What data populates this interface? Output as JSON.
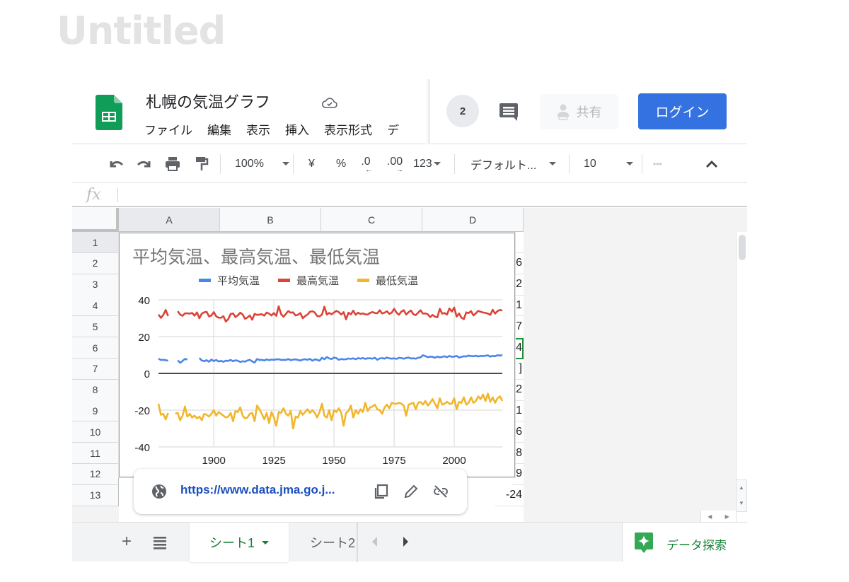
{
  "page": {
    "watermark": "Untitled"
  },
  "header": {
    "doc_title": "札幌の気温グラフ",
    "menu": [
      "ファイル",
      "編集",
      "表示",
      "挿入",
      "表示形式",
      "デ"
    ],
    "viewer_count": "2",
    "share_label": "共有",
    "login_label": "ログイン",
    "colors": {
      "login": "#3372e0",
      "sheets_green": "#0f9d58"
    }
  },
  "toolbar": {
    "zoom": "100%",
    "currency": "¥",
    "percent": "%",
    "decrease_decimal": ".0",
    "increase_decimal": ".00",
    "number_format": "123",
    "font": "デフォルト...",
    "font_size": "10",
    "more": "•••"
  },
  "formula_bar": {
    "label": "fx",
    "value": ""
  },
  "grid": {
    "columns": [
      "A",
      "B",
      "C",
      "D"
    ],
    "rows": [
      "1",
      "2",
      "3",
      "4",
      "5",
      "6",
      "7",
      "8",
      "9",
      "10",
      "11",
      "12",
      "13"
    ],
    "selected_cell": "D6",
    "column_d_visible": [
      "",
      "6",
      "2",
      "1",
      "7",
      "4",
      "]",
      "2",
      "1",
      "6",
      "8",
      "9",
      "-24"
    ]
  },
  "link_popup": {
    "url": "https://www.data.jma.go.j..."
  },
  "sheets": {
    "tabs": [
      "シート1",
      "シート2"
    ],
    "active": "シート1",
    "explore_label": "データ探索"
  },
  "chart_data": {
    "type": "line",
    "title": "平均気温、最高気温、最低気温",
    "legend_position": "top",
    "xlabel": "",
    "ylabel": "",
    "xlim": [
      1877,
      2020
    ],
    "ylim": [
      -40,
      40
    ],
    "x_ticks": [
      1900,
      1925,
      1950,
      1975,
      2000
    ],
    "y_ticks": [
      40,
      20,
      0,
      -20,
      -40
    ],
    "grid": true,
    "x_start": 1877,
    "series": [
      {
        "name": "平均気温",
        "color": "#4a86e8",
        "values": [
          8.0,
          7.3,
          7.4,
          7.2,
          6.9,
          null,
          null,
          null,
          7.1,
          5.8,
          6.7,
          7.9,
          7.5,
          null,
          null,
          null,
          null,
          8.4,
          7.0,
          6.6,
          7.2,
          6.3,
          7.5,
          6.7,
          7.3,
          6.5,
          6.8,
          6.3,
          6.9,
          6.8,
          7.3,
          6.6,
          7.1,
          6.9,
          6.2,
          6.6,
          6.4,
          7.0,
          7.4,
          6.5,
          5.9,
          7.8,
          7.3,
          7.4,
          7.0,
          7.6,
          7.2,
          7.5,
          7.4,
          7.6,
          7.7,
          7.3,
          7.4,
          7.3,
          7.8,
          7.2,
          7.5,
          7.6,
          7.3,
          7.0,
          7.5,
          7.7,
          7.4,
          7.9,
          6.9,
          7.6,
          7.4,
          6.9,
          8.5,
          7.7,
          8.9,
          8.1,
          7.8,
          8.6,
          8.3,
          7.4,
          7.8,
          7.6,
          7.7,
          8.1,
          7.9,
          8.2,
          7.7,
          8.3,
          8.0,
          8.4,
          7.9,
          8.2,
          8.2,
          8.0,
          8.5,
          7.4,
          8.1,
          8.3,
          8.0,
          8.6,
          8.2,
          8.0,
          8.2,
          7.9,
          8.5,
          8.3,
          8.0,
          8.4,
          8.6,
          8.1,
          8.2,
          8.0,
          8.5,
          8.7,
          9.9,
          9.4,
          8.8,
          9.1,
          9.0,
          8.5,
          9.2,
          8.7,
          9.0,
          9.3,
          8.8,
          9.5,
          9.0,
          9.1,
          9.5,
          8.6,
          9.0,
          9.3,
          9.2,
          9.7,
          9.4,
          9.3,
          9.6,
          9.2,
          9.5,
          9.4,
          9.6,
          9.8,
          9.1,
          9.5,
          9.3,
          9.9,
          9.7,
          10.0
        ]
      },
      {
        "name": "最高気温",
        "color": "#db4437",
        "values": [
          32.0,
          30.2,
          31.8,
          34.5,
          31.2,
          null,
          null,
          null,
          33.8,
          32.0,
          31.3,
          32.6,
          32.7,
          32.5,
          32.9,
          31.4,
          33.2,
          30.0,
          32.5,
          33.2,
          33.5,
          31.0,
          31.5,
          33.3,
          31.0,
          30.3,
          30.2,
          31.1,
          28.2,
          29.5,
          32.3,
          32.6,
          30.6,
          31.6,
          33.0,
          32.0,
          29.7,
          30.4,
          31.5,
          29.2,
          32.4,
          31.8,
          32.0,
          32.2,
          31.4,
          33.1,
          32.5,
          31.5,
          32.8,
          31.3,
          36.5,
          32.2,
          30.8,
          32.4,
          33.9,
          33.0,
          33.2,
          31.5,
          31.9,
          32.8,
          30.0,
          31.2,
          32.0,
          33.5,
          33.8,
          33.1,
          31.2,
          31.0,
          32.0,
          36.3,
          32.0,
          32.9,
          32.1,
          33.1,
          34.0,
          33.3,
          32.0,
          33.3,
          29.4,
          33.0,
          32.1,
          34.1,
          31.9,
          33.0,
          32.3,
          32.6,
          32.1,
          32.0,
          32.9,
          33.4,
          32.8,
          32.7,
          34.3,
          32.6,
          33.0,
          33.8,
          32.4,
          33.0,
          35.1,
          33.0,
          31.9,
          33.6,
          34.4,
          32.0,
          33.3,
          34.2,
          32.1,
          31.7,
          33.0,
          34.3,
          32.5,
          32.6,
          32.2,
          30.6,
          31.8,
          30.8,
          30.5,
          35.1,
          32.5,
          32.8,
          32.0,
          35.3,
          33.6,
          35.8,
          30.9,
          32.6,
          30.3,
          29.5,
          33.2,
          32.8,
          33.9,
          31.5,
          32.7,
          34.0,
          33.5,
          33.1,
          32.9,
          32.5,
          31.8,
          34.6,
          32.5,
          33.9,
          34.5,
          34.2
        ]
      },
      {
        "name": "最低気温",
        "color": "#f1b62b",
        "values": [
          -16.5,
          -22.5,
          -22.0,
          -25.0,
          -21.5,
          null,
          null,
          -21.8,
          -21.5,
          -25.5,
          -23.0,
          -18.0,
          -23.5,
          -22.0,
          -24.0,
          -23.0,
          -24.5,
          -23.5,
          -25.5,
          -22.0,
          -22.5,
          -23.5,
          -22.0,
          -20.0,
          -23.0,
          -21.0,
          -22.0,
          -23.0,
          -24.0,
          -23.5,
          -21.5,
          -26.0,
          -20.5,
          -21.0,
          -18.5,
          -23.0,
          -24.5,
          -24.0,
          -22.0,
          -21.5,
          -26.0,
          -17.5,
          -19.5,
          -22.0,
          -25.0,
          -21.5,
          -27.0,
          -21.0,
          -24.0,
          -28.5,
          -21.0,
          -21.5,
          -19.0,
          -22.0,
          -23.0,
          -20.5,
          -30.0,
          -23.5,
          -24.0,
          -20.5,
          -22.5,
          -21.0,
          -19.5,
          -21.5,
          -20.0,
          -21.5,
          -24.0,
          -21.0,
          -16.5,
          -23.0,
          -24.0,
          -20.0,
          -25.5,
          -20.0,
          -21.0,
          -19.0,
          -21.5,
          -28.5,
          -21.5,
          -20.5,
          -17.5,
          -24.0,
          -20.0,
          -22.0,
          -19.5,
          -21.0,
          -16.0,
          -20.5,
          -18.5,
          -18.0,
          -17.0,
          -19.5,
          -20.0,
          -22.0,
          -18.5,
          -17.0,
          -19.0,
          -16.0,
          -16.5,
          -16.5,
          -16.0,
          -16.5,
          -17.5,
          -23.0,
          -17.0,
          -16.5,
          -16.0,
          -19.5,
          -16.0,
          -15.5,
          -17.0,
          -15.0,
          -17.5,
          -16.0,
          -14.0,
          -16.5,
          -19.0,
          -13.5,
          -17.0,
          -16.5,
          -15.5,
          -16.5,
          -16.5,
          -13.5,
          -19.5,
          -15.5,
          -16.0,
          -13.0,
          -17.0,
          -16.0,
          -13.0,
          -16.0,
          -15.0,
          -12.5,
          -14.0,
          -11.5,
          -15.0,
          -11.0,
          -15.5,
          -13.0,
          -16.0,
          -13.5,
          -12.5,
          -15.0
        ]
      }
    ]
  }
}
